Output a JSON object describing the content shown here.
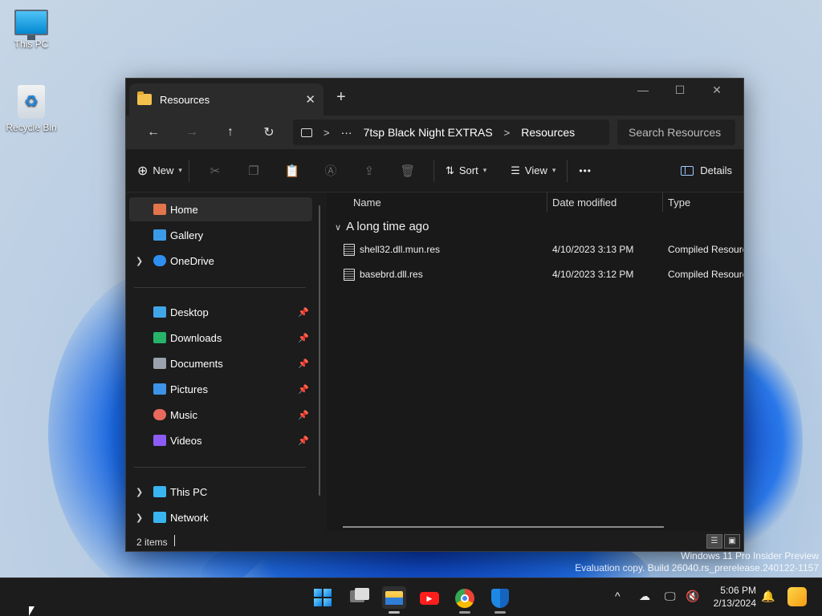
{
  "desktop": {
    "icons": [
      {
        "label": "This PC",
        "icon": "this-pc-icon"
      },
      {
        "label": "Recycle Bin",
        "icon": "recycle-bin-icon"
      }
    ],
    "watermark_line1": "Windows 11 Pro Insider Preview",
    "watermark_line2": "Evaluation copy. Build 26040.rs_prerelease.240122-1157"
  },
  "explorer": {
    "tab_title": "Resources",
    "tab_close": "✕",
    "new_tab": "+",
    "window_controls": {
      "minimize": "—",
      "maximize": "☐",
      "close": "✕"
    },
    "nav": {
      "back": "←",
      "forward": "→",
      "up": "↑",
      "refresh": "↻"
    },
    "breadcrumb": {
      "more": "···",
      "items": [
        "7tsp Black Night EXTRAS",
        "Resources"
      ],
      "separator": ">"
    },
    "search_placeholder": "Search Resources",
    "toolbar": {
      "new_label": "New",
      "sort_label": "Sort",
      "view_label": "View",
      "more_label": "•••",
      "details_label": "Details"
    },
    "sidebar": {
      "quick": [
        {
          "label": "Home",
          "icon": "home-icon",
          "color": "#e2754b",
          "selected": true
        },
        {
          "label": "Gallery",
          "icon": "gallery-icon",
          "color": "#3c9be8"
        },
        {
          "label": "OneDrive",
          "icon": "onedrive-icon",
          "color": "#2f8ff0",
          "expandable": true
        }
      ],
      "pinned": [
        {
          "label": "Desktop",
          "icon": "desktop-icon",
          "color": "#41a6e8"
        },
        {
          "label": "Downloads",
          "icon": "downloads-icon",
          "color": "#27b36a"
        },
        {
          "label": "Documents",
          "icon": "documents-icon",
          "color": "#9aa3ad"
        },
        {
          "label": "Pictures",
          "icon": "pictures-icon",
          "color": "#3d94e6"
        },
        {
          "label": "Music",
          "icon": "music-icon",
          "color": "#e86a5c"
        },
        {
          "label": "Videos",
          "icon": "videos-icon",
          "color": "#8b5cf6"
        }
      ],
      "devices": [
        {
          "label": "This PC",
          "icon": "this-pc-icon",
          "color": "#3ab4f0"
        },
        {
          "label": "Network",
          "icon": "network-icon",
          "color": "#3ab4f0"
        }
      ]
    },
    "columns": {
      "name": "Name",
      "date_modified": "Date modified",
      "type": "Type"
    },
    "group_label": "A long time ago",
    "files": [
      {
        "name": "shell32.dll.mun.res",
        "date": "4/10/2023 3:13 PM",
        "type": "Compiled Resource"
      },
      {
        "name": "basebrd.dll.res",
        "date": "4/10/2023 3:12 PM",
        "type": "Compiled Resource"
      }
    ],
    "status_count": "2 items"
  },
  "taskbar": {
    "apps": [
      "start-icon",
      "task-view-icon",
      "file-explorer-icon",
      "youtube-icon",
      "chrome-icon",
      "defender-icon"
    ],
    "tray": {
      "overflow": "^",
      "time": "5:06 PM",
      "date": "2/13/2024"
    }
  }
}
